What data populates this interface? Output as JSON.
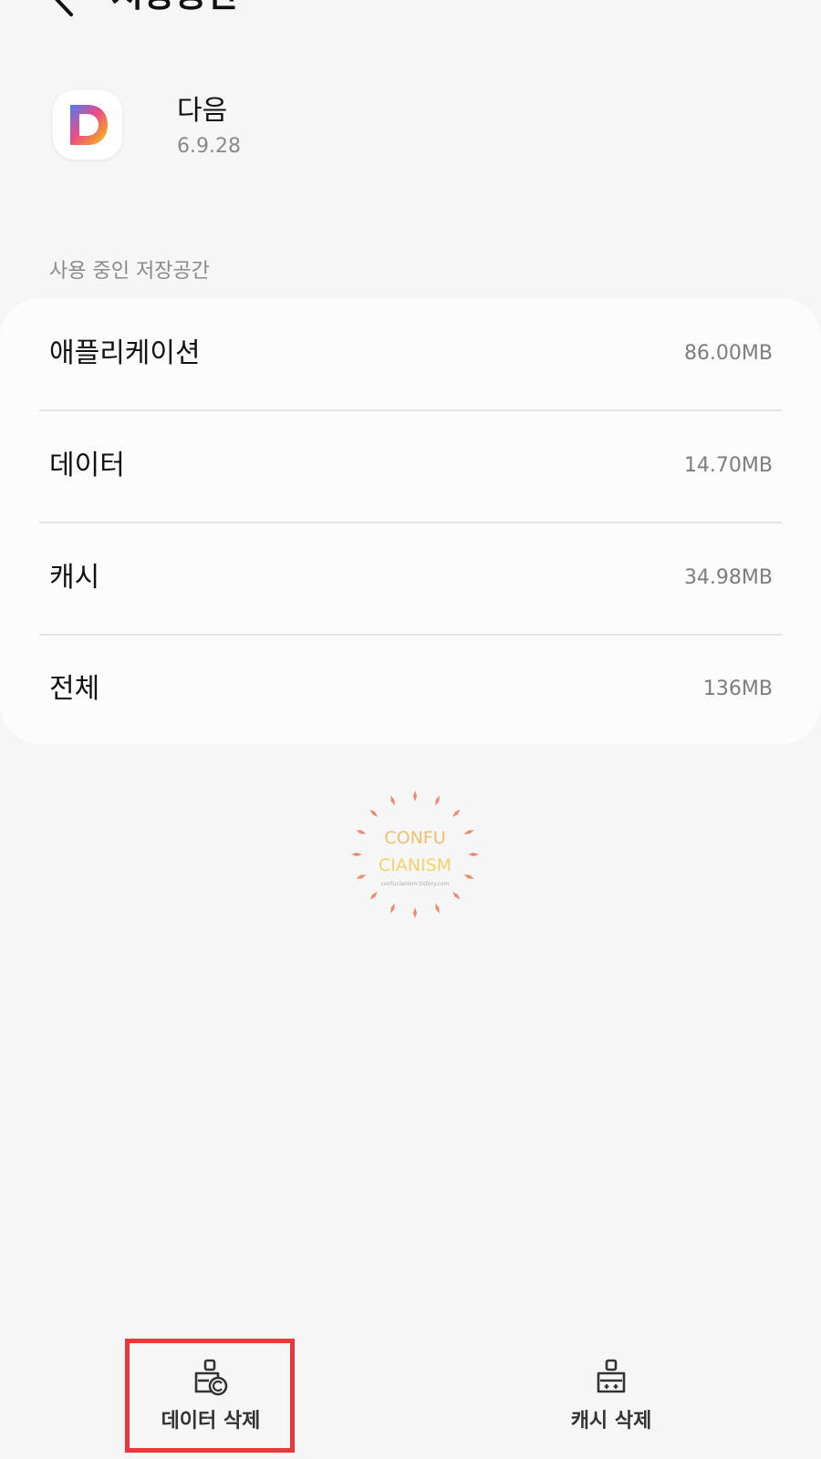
{
  "header": {
    "title": "저장공간"
  },
  "app": {
    "name": "다음",
    "version": "6.9.28",
    "icon": "daum-d-logo-icon"
  },
  "storage": {
    "section_label": "사용 중인 저장공간",
    "rows": [
      {
        "label": "애플리케이션",
        "value": "86.00MB"
      },
      {
        "label": "데이터",
        "value": "14.70MB"
      },
      {
        "label": "캐시",
        "value": "34.98MB"
      },
      {
        "label": "전체",
        "value": "136MB"
      }
    ]
  },
  "watermark": {
    "line1": "CONFU",
    "line2": "CIANISM",
    "line3": "confucianism.tistory.com"
  },
  "actions": {
    "clear_data": {
      "label": "데이터 삭제",
      "icon": "clear-data-brush-icon"
    },
    "clear_cache": {
      "label": "캐시 삭제",
      "icon": "clear-cache-brush-icon"
    }
  },
  "colors": {
    "background": "#f6f6f6",
    "card": "#fcfcfc",
    "highlight": "#e8383b",
    "secondary_text": "#8a8a8a"
  }
}
